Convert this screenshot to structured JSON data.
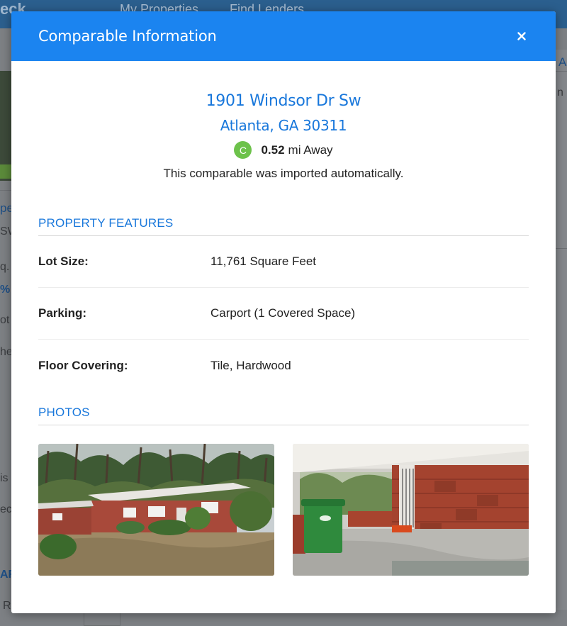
{
  "background": {
    "logo": "eck",
    "nav": [
      "My Properties",
      "Find Lenders"
    ],
    "fragments": [
      "A",
      "n",
      "pe",
      "SW",
      "q.",
      "%",
      "ot",
      "he",
      "is",
      "ec",
      "AR",
      "R"
    ]
  },
  "modal": {
    "title": "Comparable Information",
    "close_icon": "close-icon"
  },
  "summary": {
    "address_line1": "1901 Windsor Dr Sw",
    "address_line2": "Atlanta, GA 30311",
    "grade": "C",
    "grade_color": "#6dc24b",
    "distance_value": "0.52",
    "distance_unit": "mi Away",
    "import_note": "This comparable was imported automatically."
  },
  "features": {
    "heading": "PROPERTY FEATURES",
    "rows": [
      {
        "label": "Lot Size:",
        "value": "11,761 Square Feet"
      },
      {
        "label": "Parking:",
        "value": "Carport (1 Covered Space)"
      },
      {
        "label": "Floor Covering:",
        "value": "Tile, Hardwood"
      }
    ]
  },
  "photos": {
    "heading": "PHOTOS",
    "items": [
      "house-exterior-photo",
      "carport-photo"
    ]
  },
  "colors": {
    "accent": "#1b84f0",
    "link": "#1877db"
  }
}
